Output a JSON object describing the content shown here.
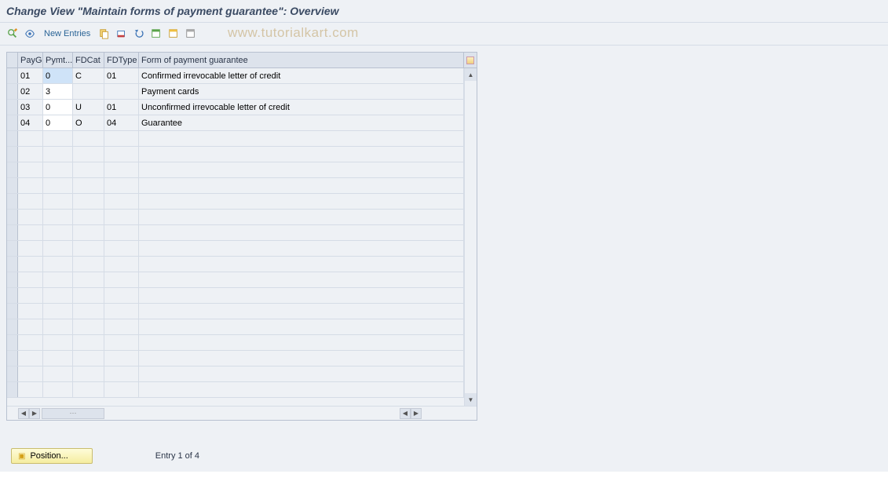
{
  "title": "Change View \"Maintain forms of payment guarantee\": Overview",
  "toolbar": {
    "new_entries": "New Entries"
  },
  "watermark": "www.tutorialkart.com",
  "table": {
    "columns": {
      "payg": "PayG",
      "pymt": "Pymt...",
      "fdcat": "FDCat",
      "fdtype": "FDType",
      "desc": "Form of payment guarantee"
    },
    "rows": [
      {
        "payg": "01",
        "pymt": "0",
        "fdcat": "C",
        "fdtype": "01",
        "desc": "Confirmed irrevocable letter of credit"
      },
      {
        "payg": "02",
        "pymt": "3",
        "fdcat": "",
        "fdtype": "",
        "desc": "Payment cards"
      },
      {
        "payg": "03",
        "pymt": "0",
        "fdcat": "U",
        "fdtype": "01",
        "desc": "Unconfirmed irrevocable letter of credit"
      },
      {
        "payg": "04",
        "pymt": "0",
        "fdcat": "O",
        "fdtype": "04",
        "desc": "Guarantee"
      }
    ]
  },
  "footer": {
    "position_label": "Position...",
    "entry_info": "Entry 1 of 4"
  }
}
